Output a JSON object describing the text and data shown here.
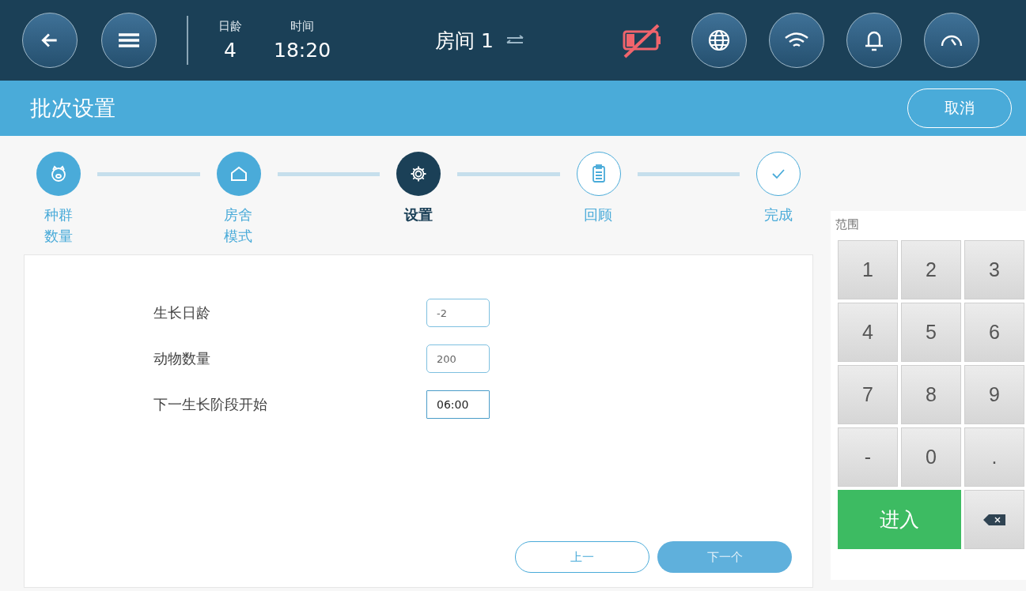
{
  "header": {
    "day_label": "日龄",
    "day_value": "4",
    "time_label": "时间",
    "time_value": "18:20",
    "room": "房间 1"
  },
  "title_bar": {
    "title": "批次设置",
    "cancel": "取消"
  },
  "steps": [
    {
      "label": "种群数量",
      "kind": "pig",
      "done": true,
      "selected": false
    },
    {
      "label": "房舍模式",
      "kind": "house",
      "done": true,
      "selected": false
    },
    {
      "label": "设置",
      "kind": "gear",
      "done": false,
      "selected": true
    },
    {
      "label": "回顾",
      "kind": "clipboard",
      "done": false,
      "selected": false
    },
    {
      "label": "完成",
      "kind": "check",
      "done": false,
      "selected": false
    }
  ],
  "fields": [
    {
      "label": "生长日龄",
      "value": "-2",
      "selected": false
    },
    {
      "label": "动物数量",
      "value": "200",
      "selected": false
    },
    {
      "label": "下一生长阶段开始",
      "value": "06:00",
      "selected": true
    }
  ],
  "buttons": {
    "back": "上一",
    "next": "下一个"
  },
  "keypad": {
    "range_label": "范围",
    "keys": [
      {
        "kind": "digit",
        "text": "1"
      },
      {
        "kind": "digit",
        "text": "2"
      },
      {
        "kind": "digit",
        "text": "3"
      },
      {
        "kind": "digit",
        "text": "4"
      },
      {
        "kind": "digit",
        "text": "5"
      },
      {
        "kind": "digit",
        "text": "6"
      },
      {
        "kind": "digit",
        "text": "7"
      },
      {
        "kind": "digit",
        "text": "8"
      },
      {
        "kind": "digit",
        "text": "9"
      },
      {
        "kind": "digit",
        "text": "-"
      },
      {
        "kind": "digit",
        "text": "0"
      },
      {
        "kind": "digit",
        "text": "."
      },
      {
        "kind": "enter",
        "text": "进入"
      },
      {
        "kind": "backspace"
      }
    ]
  }
}
